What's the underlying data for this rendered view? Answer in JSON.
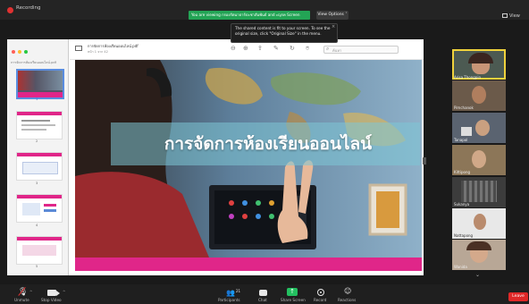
{
  "topbar": {
    "recording_label": "Recording",
    "share_notice": "You are viewing กรองรัตนาธาร์ปะชาสัมพันธ์ and ะญรค Screen",
    "view_options_label": "View Options ˅",
    "view_label": "View"
  },
  "tooltip": {
    "text": "The shared content is fit to your screen. To see the original size, click \"Original Size\" in the menu."
  },
  "document": {
    "panel_title": "การจัดการห้องเรียนออนไลน์.pdf",
    "title": "การจัดการห้องเรียนออนไลน์.pdf",
    "subtitle": "หน้า 1 จาก 42",
    "search_placeholder": "ค้นหา",
    "thumbnails": [
      "1",
      "2",
      "3",
      "4",
      "5"
    ]
  },
  "slide": {
    "title": "การจัดการห้องเรียนออนไลน์"
  },
  "participants": [
    {
      "name": "Arisa Thongpin"
    },
    {
      "name": "Pimchanok"
    },
    {
      "name": "Tanapol"
    },
    {
      "name": "Kittipong"
    },
    {
      "name": "Sukanya"
    },
    {
      "name": "Nattapong"
    },
    {
      "name": "Wanida"
    }
  ],
  "toolbar": {
    "unmute": "Unmute",
    "stop_video": "Stop Video",
    "participants": "Participants",
    "participants_count": "21",
    "chat": "Chat",
    "share_screen": "Share Screen",
    "record": "Record",
    "reactions": "Reactions",
    "leave": "Leave"
  },
  "colors": {
    "share_banner": "#23a455",
    "slide_accent": "#e02689",
    "leave": "#e02828",
    "active_speaker_border": "#f0d23c"
  }
}
